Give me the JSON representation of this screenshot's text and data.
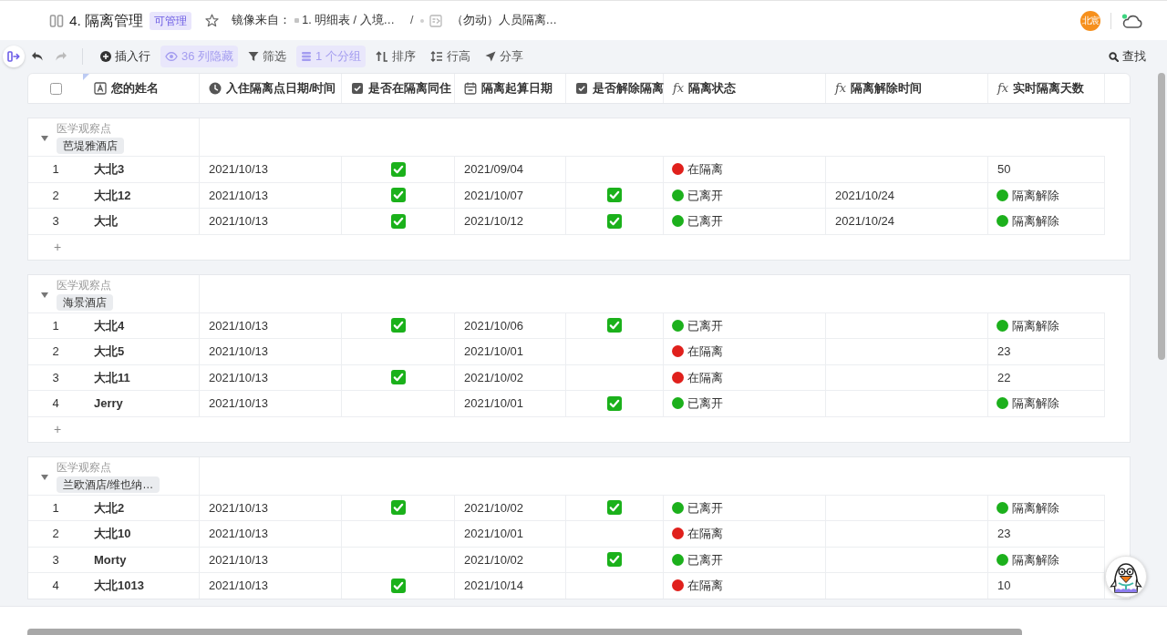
{
  "title_bar": {
    "title": "4. 隔离管理",
    "permission": "可管理",
    "starred": false,
    "source": {
      "label": "镜像来自：",
      "table": "1. 明细表 / 入境…",
      "separator": "/",
      "view": "（勿动）人员隔离…"
    },
    "user_avatar": "北宸"
  },
  "toolbar": {
    "undo": {
      "disabled": false
    },
    "redo": {
      "disabled": true
    },
    "items": [
      {
        "kind": "insert",
        "label": "插入行",
        "active": false
      },
      {
        "kind": "hide",
        "label": "36 列隐藏",
        "active": true
      },
      {
        "kind": "filter",
        "label": "筛选",
        "active": false
      },
      {
        "kind": "group",
        "label": "1 个分组",
        "active": true
      },
      {
        "kind": "sort",
        "label": "排序",
        "active": false
      },
      {
        "kind": "row_height",
        "label": "行高",
        "active": false
      },
      {
        "kind": "share",
        "label": "分享",
        "active": false
      }
    ],
    "search_label": "查找"
  },
  "table": {
    "select_all": {
      "checked": false
    },
    "columns": [
      {
        "kind": "text",
        "label": "您的姓名"
      },
      {
        "kind": "datetime",
        "label": "入住隔离点日期/时间"
      },
      {
        "kind": "checkbox",
        "label": "是否在隔离同住"
      },
      {
        "kind": "date",
        "label": "隔离起算日期"
      },
      {
        "kind": "checkbox",
        "label": "是否解除隔离"
      },
      {
        "kind": "formula",
        "glyph": "fx",
        "label": "隔离状态"
      },
      {
        "kind": "formula",
        "glyph": "fx",
        "label": "隔离解除时间"
      },
      {
        "kind": "formula",
        "glyph": "fx",
        "label": "实时隔离天数"
      }
    ],
    "groups": [
      {
        "field": "医学观察点",
        "value": "芭堤雅酒店",
        "expanded": true,
        "add_row": "+",
        "rows": [
          {
            "index": "1",
            "name": "大北3",
            "checkin": "2021/10/13",
            "cohabiting": true,
            "start": "2021/09/04",
            "released": false,
            "status": {
              "label": "在隔离",
              "color": "#e0201c"
            },
            "days": {
              "label": "50"
            }
          },
          {
            "index": "2",
            "name": "大北12",
            "checkin": "2021/10/13",
            "cohabiting": true,
            "start": "2021/10/07",
            "released": true,
            "status": {
              "label": "已离开",
              "color": "#1cb01c"
            },
            "release_time": "2021/10/24",
            "days": {
              "label": "隔离解除",
              "color": "#1cb01c"
            }
          },
          {
            "index": "3",
            "name": "大北",
            "checkin": "2021/10/13",
            "cohabiting": true,
            "start": "2021/10/12",
            "released": true,
            "status": {
              "label": "已离开",
              "color": "#1cb01c"
            },
            "release_time": "2021/10/24",
            "days": {
              "label": "隔离解除",
              "color": "#1cb01c"
            }
          }
        ]
      },
      {
        "field": "医学观察点",
        "value": "海景酒店",
        "expanded": true,
        "add_row": "+",
        "rows": [
          {
            "index": "1",
            "name": "大北4",
            "checkin": "2021/10/13",
            "cohabiting": true,
            "start": "2021/10/06",
            "released": true,
            "status": {
              "label": "已离开",
              "color": "#1cb01c"
            },
            "days": {
              "label": "隔离解除",
              "color": "#1cb01c"
            }
          },
          {
            "index": "2",
            "name": "大北5",
            "checkin": "2021/10/13",
            "cohabiting": false,
            "start": "2021/10/01",
            "released": false,
            "status": {
              "label": "在隔离",
              "color": "#e0201c"
            },
            "days": {
              "label": "23"
            }
          },
          {
            "index": "3",
            "name": "大北11",
            "checkin": "2021/10/13",
            "cohabiting": true,
            "start": "2021/10/02",
            "released": false,
            "status": {
              "label": "在隔离",
              "color": "#e0201c"
            },
            "days": {
              "label": "22"
            }
          },
          {
            "index": "4",
            "name": "Jerry",
            "checkin": "2021/10/13",
            "cohabiting": false,
            "start": "2021/10/01",
            "released": true,
            "status": {
              "label": "已离开",
              "color": "#1cb01c"
            },
            "days": {
              "label": "隔离解除",
              "color": "#1cb01c"
            }
          }
        ]
      },
      {
        "field": "医学观察点",
        "value": "兰欧酒店/维也纳…",
        "expanded": true,
        "rows": [
          {
            "index": "1",
            "name": "大北2",
            "checkin": "2021/10/13",
            "cohabiting": true,
            "start": "2021/10/02",
            "released": true,
            "status": {
              "label": "已离开",
              "color": "#1cb01c"
            },
            "days": {
              "label": "隔离解除",
              "color": "#1cb01c"
            }
          },
          {
            "index": "2",
            "name": "大北10",
            "checkin": "2021/10/13",
            "cohabiting": false,
            "start": "2021/10/01",
            "released": false,
            "status": {
              "label": "在隔离",
              "color": "#e0201c"
            },
            "days": {
              "label": "23"
            }
          },
          {
            "index": "3",
            "name": "Morty",
            "checkin": "2021/10/13",
            "cohabiting": false,
            "start": "2021/10/02",
            "released": true,
            "status": {
              "label": "已离开",
              "color": "#1cb01c"
            },
            "days": {
              "label": "隔离解除",
              "color": "#1cb01c"
            }
          },
          {
            "index": "4",
            "name": "大北1013",
            "checkin": "2021/10/13",
            "cohabiting": true,
            "start": "2021/10/14",
            "released": false,
            "status": {
              "label": "在隔离",
              "color": "#e0201c"
            },
            "days": {
              "label": "10"
            }
          }
        ]
      }
    ]
  }
}
